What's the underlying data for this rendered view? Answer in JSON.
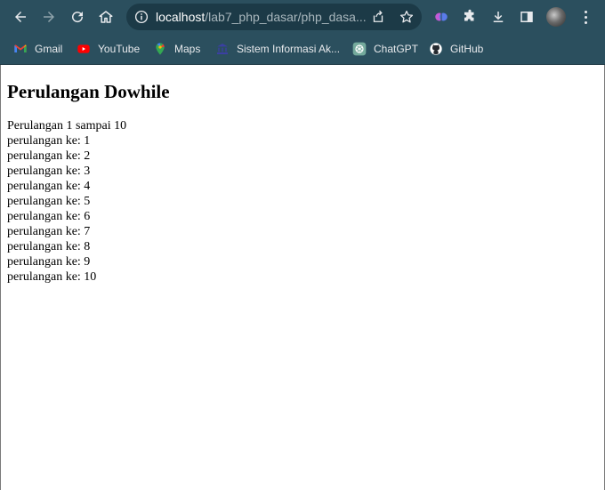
{
  "browser": {
    "url_host": "localhost",
    "url_path": "/lab7_php_dasar/php_dasa...",
    "bookmarks": [
      {
        "label": "Gmail",
        "icon": "gmail-icon"
      },
      {
        "label": "YouTube",
        "icon": "youtube-icon"
      },
      {
        "label": "Maps",
        "icon": "maps-icon"
      },
      {
        "label": "Sistem Informasi Ak...",
        "icon": "university-icon"
      },
      {
        "label": "ChatGPT",
        "icon": "chatgpt-icon"
      },
      {
        "label": "GitHub",
        "icon": "github-icon"
      }
    ]
  },
  "page": {
    "heading": "Perulangan Dowhile",
    "intro": "Perulangan 1 sampai 10",
    "lines": [
      "perulangan ke: 1",
      "perulangan ke: 2",
      "perulangan ke: 3",
      "perulangan ke: 4",
      "perulangan ke: 5",
      "perulangan ke: 6",
      "perulangan ke: 7",
      "perulangan ke: 8",
      "perulangan ke: 9",
      "perulangan ke: 10"
    ]
  },
  "colors": {
    "toolbar_bg": "#2b4f5e",
    "omnibox_bg": "#1c3a47",
    "page_bg": "#ffffff"
  }
}
